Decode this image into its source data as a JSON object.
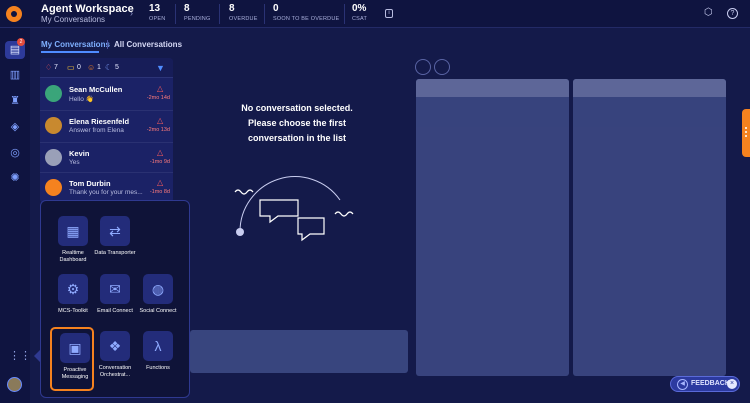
{
  "header": {
    "title": "Agent Workspace",
    "subtitle": "My Conversations",
    "stats": [
      {
        "value": "13",
        "label": "OPEN"
      },
      {
        "value": "8",
        "label": "PENDING"
      },
      {
        "value": "8",
        "label": "OVERDUE"
      },
      {
        "value": "0",
        "label": "SOON TO BE OVERDUE"
      },
      {
        "value": "0%",
        "label": "CSAT"
      }
    ]
  },
  "rail": {
    "badge": "2"
  },
  "tabs": {
    "my": "My Conversations",
    "all": "All Conversations"
  },
  "filters": {
    "alerts": "7",
    "chats": "0",
    "users": "1",
    "snoozed": "5"
  },
  "conversations": [
    {
      "name": "Sean McCullen",
      "message": "Hello 👋",
      "time": "-2mo 14d"
    },
    {
      "name": "Elena Riesenfeld",
      "message": "Answer from Elena",
      "time": "-2mo 13d"
    },
    {
      "name": "Kevin",
      "message": "Yes",
      "time": "-1mo 9d"
    },
    {
      "name": "Tom Durbin",
      "message": "Thank you for your mes...",
      "time": "-1mo 8d"
    }
  ],
  "empty_state": {
    "line1": "No conversation selected.",
    "line2": "Please choose the first",
    "line3": "conversation in the list"
  },
  "apps": [
    {
      "label": "Realtime Dashboard",
      "icon": "dashboard-icon"
    },
    {
      "label": "Data Transporter",
      "icon": "transfer-icon"
    },
    {
      "label": "MCS-Toolkit",
      "icon": "toolkit-icon"
    },
    {
      "label": "Email Connect",
      "icon": "email-icon"
    },
    {
      "label": "Social Connect",
      "icon": "social-icon"
    },
    {
      "label": "Proactive Messaging",
      "icon": "messaging-icon"
    },
    {
      "label": "Conversation Orchestrat...",
      "icon": "orchestrator-icon"
    },
    {
      "label": "Functions",
      "icon": "lambda-icon"
    }
  ],
  "feedback": {
    "label": "FEEDBACK"
  },
  "colors": {
    "accent": "#f5821f",
    "primary": "#4f8cff",
    "background": "#141a4a"
  }
}
